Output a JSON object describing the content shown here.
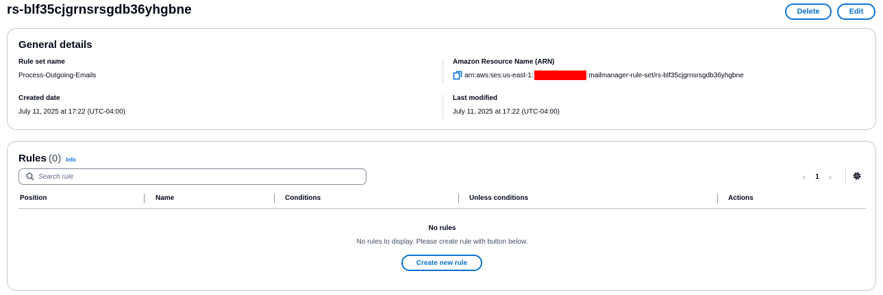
{
  "header": {
    "title": "rs-blf35cjgrnsrsgdb36yhgbne",
    "delete_label": "Delete",
    "edit_label": "Edit"
  },
  "general": {
    "title": "General details",
    "rule_set_name_label": "Rule set name",
    "rule_set_name": "Process-Outgoing-Emails",
    "created_label": "Created date",
    "created_value": "July 11, 2025 at 17:22 (UTC-04:00)",
    "arn_label": "Amazon Resource Name (ARN)",
    "arn_prefix": "arn:aws:ses:us-east-1:",
    "arn_suffix": ":mailmanager-rule-set/rs-blf35cjgrnsrsgdb36yhgbne",
    "modified_label": "Last modified",
    "modified_value": "July 11, 2025 at 17:22 (UTC-04:00)"
  },
  "rules": {
    "title": "Rules",
    "count": "(0)",
    "info": "Info",
    "search_placeholder": "Search rule",
    "page": "1",
    "columns": [
      "Position",
      "Name",
      "Conditions",
      "Unless conditions",
      "Actions"
    ],
    "empty_title": "No rules",
    "empty_desc": "No rules to display. Please create rule with button below.",
    "create_label": "Create new rule"
  },
  "icons": {
    "copy": "copy-icon",
    "search": "search-icon",
    "settings": "gear-icon",
    "prev": "chevron-left-icon",
    "next": "chevron-right-icon"
  },
  "colors": {
    "accent": "#0972d3",
    "redaction": "#ff0000"
  }
}
